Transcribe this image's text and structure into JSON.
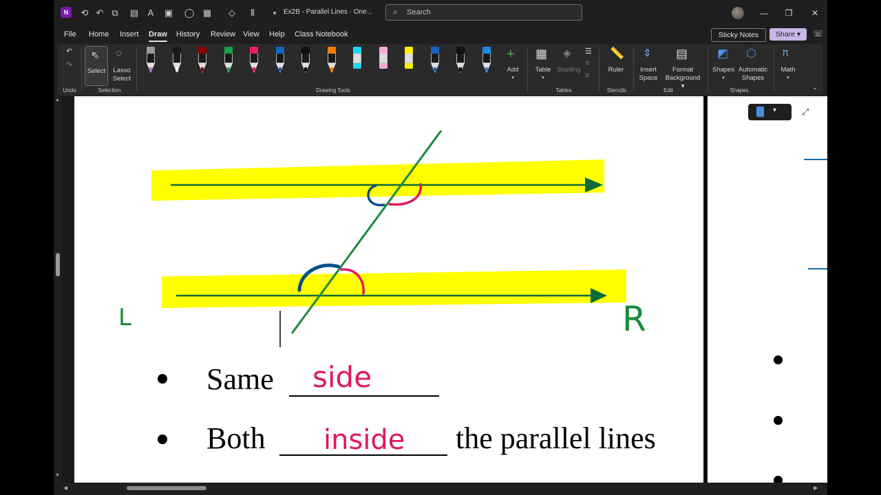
{
  "app": {
    "doc_title": "Ex2B - Parallel Lines · One...",
    "search_placeholder": "Search",
    "logo_letter": "N"
  },
  "menu": {
    "items": [
      "File",
      "Home",
      "Insert",
      "Draw",
      "History",
      "Review",
      "View",
      "Help",
      "Class Notebook"
    ],
    "active": "Draw",
    "sticky_notes": "Sticky Notes",
    "share": "Share"
  },
  "ribbon": {
    "undo_group": "Undo",
    "select": "Select",
    "lasso_select": [
      "Lasso",
      "Select"
    ],
    "selection_group": "Selection",
    "drawing_tools_group": "Drawing Tools",
    "add": "Add",
    "table": "Table",
    "shading": "Shading",
    "tables_group": "Tables",
    "ruler": "Ruler",
    "stencils_group": "Stencils",
    "insert_space": [
      "Insert",
      "Space"
    ],
    "format_background": [
      "Format",
      "Background"
    ],
    "edit_group": "Edit",
    "shapes": "Shapes",
    "automatic_shapes": [
      "Automatic",
      "Shapes"
    ],
    "shapes_group": "Shapes",
    "math": "Math",
    "pens": [
      {
        "type": "pencil",
        "color": "#9a9a9a",
        "accent": "#b06ad6"
      },
      {
        "type": "pen",
        "color": "#1a1a1a",
        "accent": "#ffffff"
      },
      {
        "type": "pen",
        "color": "#8b0000",
        "accent": "#8b0000"
      },
      {
        "type": "pen",
        "color": "#16a34a",
        "accent": "#16a34a"
      },
      {
        "type": "pen",
        "color": "#e91e63",
        "accent": "#e91e63"
      },
      {
        "type": "pen",
        "color": "#1565c0",
        "accent": "#1565c0"
      },
      {
        "type": "pen",
        "color": "#111111",
        "accent": "#111111"
      },
      {
        "type": "pen",
        "color": "#f57c00",
        "accent": "#f57c00"
      },
      {
        "type": "highlighter",
        "color": "#22d3ee",
        "accent": "#22d3ee"
      },
      {
        "type": "highlighter",
        "color": "#f9a8d4",
        "accent": "#f9a8d4"
      },
      {
        "type": "highlighter",
        "color": "#ffee00",
        "accent": "#ffee00"
      },
      {
        "type": "pen",
        "color": "#1565c0",
        "accent": "#1565c0"
      },
      {
        "type": "pen",
        "color": "#111111",
        "accent": "#111111"
      },
      {
        "type": "pen",
        "color": "#1e88e5",
        "accent": "#1e88e5"
      }
    ]
  },
  "page": {
    "bullet1_text": "Same",
    "bullet1_answer": "side",
    "bullet2_text": "Both",
    "bullet2_answer": "inside",
    "bullet2_tail": "the parallel lines",
    "label_left": "L",
    "label_right": "R"
  },
  "colors": {
    "highlight": "#ffff00",
    "arrow_line": "#0b6b3a",
    "transversal": "#1a8a3c",
    "ink_pink": "#e0185a",
    "ink_blue": "#0b4f8a",
    "label_green": "#1a8a3c"
  }
}
